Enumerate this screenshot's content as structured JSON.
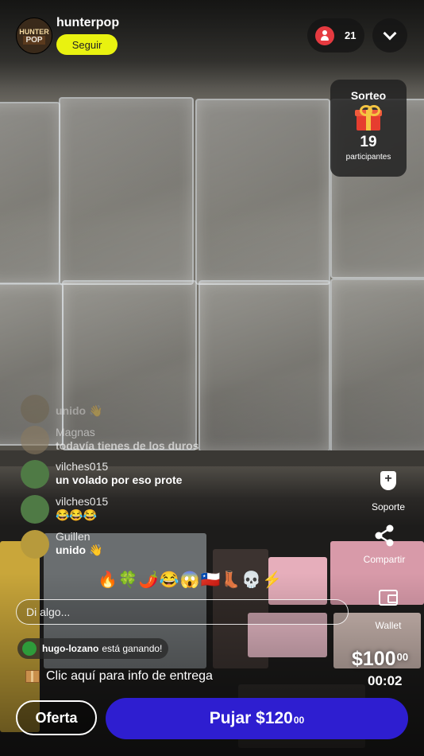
{
  "header": {
    "username": "hunterpop",
    "avatar_text": [
      "HUNTER",
      "POP"
    ],
    "follow_label": "Seguir",
    "viewer_count": "21"
  },
  "giveaway": {
    "title": "Sorteo",
    "icon": "gift-icon",
    "count": "19",
    "label": "participantes"
  },
  "chat": {
    "messages": [
      {
        "user": "",
        "text": "unido 👋",
        "avatar_color": "#6b5a3a"
      },
      {
        "user": "Magnas",
        "text": "todavía tienes de los duros",
        "avatar_color": "#8a7a60"
      },
      {
        "user": "vilches015",
        "text": "un volado por eso prote",
        "avatar_color": "#4f7a45"
      },
      {
        "user": "vilches015",
        "text": "😂😂😂",
        "avatar_color": "#4f7a45"
      },
      {
        "user": "Guillen",
        "text": "unido 👋",
        "avatar_color": "#b79a3c"
      }
    ],
    "emoji_bar": "🔥🍀🌶️😂😱🇨🇱👢💀⚡",
    "input_placeholder": "Di algo..."
  },
  "winner": {
    "user": "hugo-lozano",
    "text": "está ganando!"
  },
  "delivery": {
    "text": "Clic aquí para info de entrega"
  },
  "rail": {
    "support_label": "Soporte",
    "share_label": "Compartir",
    "wallet_label": "Wallet"
  },
  "auction": {
    "price_main": "$100",
    "price_cents": "00",
    "timer": "00:02",
    "offer_label": "Oferta",
    "bid_label": "Pujar $120",
    "bid_cents": "00"
  },
  "colors": {
    "follow_bg": "#e9f210",
    "bid_bg": "#2e1ed0",
    "viewer_icon": "#e53a40"
  }
}
